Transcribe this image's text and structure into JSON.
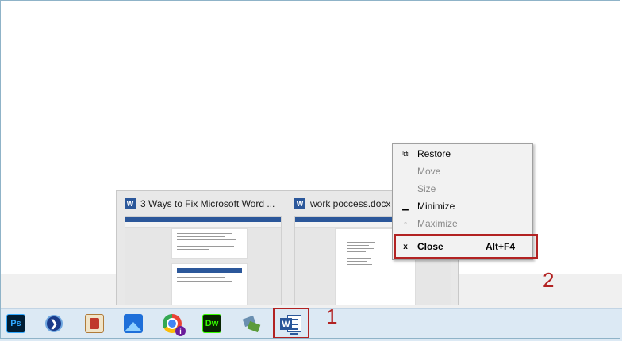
{
  "taskbar": {
    "apps": [
      {
        "name": "photoshop",
        "label": "Ps"
      },
      {
        "name": "remote-desktop",
        "label": ""
      },
      {
        "name": "archiver",
        "label": ""
      },
      {
        "name": "photos",
        "label": ""
      },
      {
        "name": "chrome",
        "label": ""
      },
      {
        "name": "dreamweaver",
        "label": "Dw"
      },
      {
        "name": "network",
        "label": ""
      },
      {
        "name": "word",
        "label": "W"
      }
    ]
  },
  "preview": {
    "windows": [
      {
        "title": "3 Ways to Fix Microsoft Word ...",
        "icon": "word-icon"
      },
      {
        "title": "work poccess.docx",
        "icon": "word-icon"
      }
    ]
  },
  "context_menu": {
    "items": [
      {
        "label": "Restore",
        "icon": "restore-icon",
        "enabled": true
      },
      {
        "label": "Move",
        "icon": "",
        "enabled": false
      },
      {
        "label": "Size",
        "icon": "",
        "enabled": false
      },
      {
        "label": "Minimize",
        "icon": "minimize-icon",
        "enabled": true
      },
      {
        "label": "Maximize",
        "icon": "maximize-icon",
        "enabled": false
      },
      {
        "label": "Close",
        "icon": "close-icon",
        "enabled": true,
        "shortcut": "Alt+F4"
      }
    ]
  },
  "annotations": {
    "step1": "1",
    "step2": "2"
  },
  "colors": {
    "annotation_red": "#b22222",
    "taskbar": "#dce9f4",
    "word_blue": "#2b579a"
  }
}
